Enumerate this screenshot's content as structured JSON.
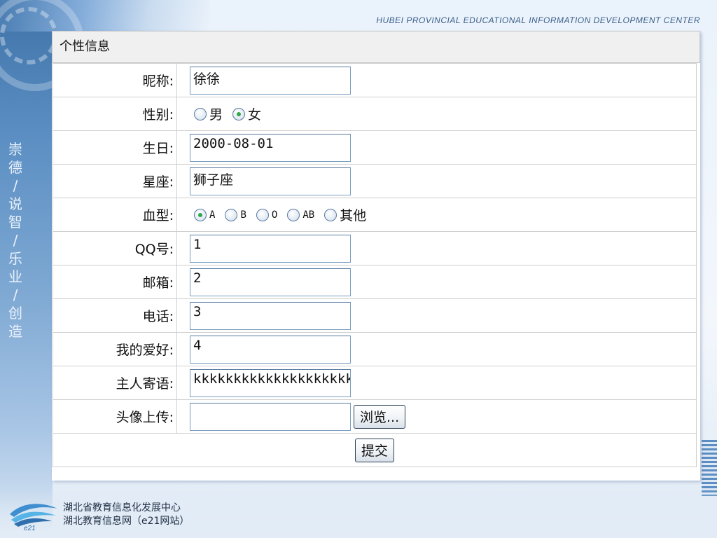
{
  "header": {
    "center_name_en": "HUBEI PROVINCIAL EDUCATIONAL INFORMATION DEVELOPMENT CENTER"
  },
  "slogan": [
    "崇",
    "德",
    "/",
    "说",
    "智",
    "/",
    "乐",
    "业",
    "/",
    "创",
    "造"
  ],
  "panel": {
    "title": "个性信息"
  },
  "form": {
    "nickname": {
      "label": "昵称:",
      "value": "徐徐"
    },
    "gender": {
      "label": "性别:",
      "options": [
        "男",
        "女"
      ],
      "selected": "女"
    },
    "birthday": {
      "label": "生日:",
      "value": "2000-08-01"
    },
    "zodiac": {
      "label": "星座:",
      "value": "狮子座"
    },
    "blood_type": {
      "label": "血型:",
      "options": [
        "A",
        "B",
        "O",
        "AB",
        "其他"
      ],
      "selected": "A"
    },
    "qq": {
      "label": "QQ号:",
      "value": "1"
    },
    "email": {
      "label": "邮箱:",
      "value": "2"
    },
    "phone": {
      "label": "电话:",
      "value": "3"
    },
    "hobbies": {
      "label": "我的爱好:",
      "value": "4"
    },
    "owner_message": {
      "label": "主人寄语:",
      "value": "kkkkkkkkkkkkkkkkkkkk"
    },
    "avatar": {
      "label": "头像上传:",
      "value": "",
      "browse_label": "浏览..."
    },
    "submit_label": "提交"
  },
  "footer": {
    "org_name": "湖北省教育信息化发展中心",
    "site_name": "湖北教育信息网（e21网站）",
    "logo_text": "e21"
  },
  "colors": {
    "panel_border": "#cfcfcf",
    "radio_checked": "#2fa84a",
    "accent_blue": "#3f73a8"
  }
}
